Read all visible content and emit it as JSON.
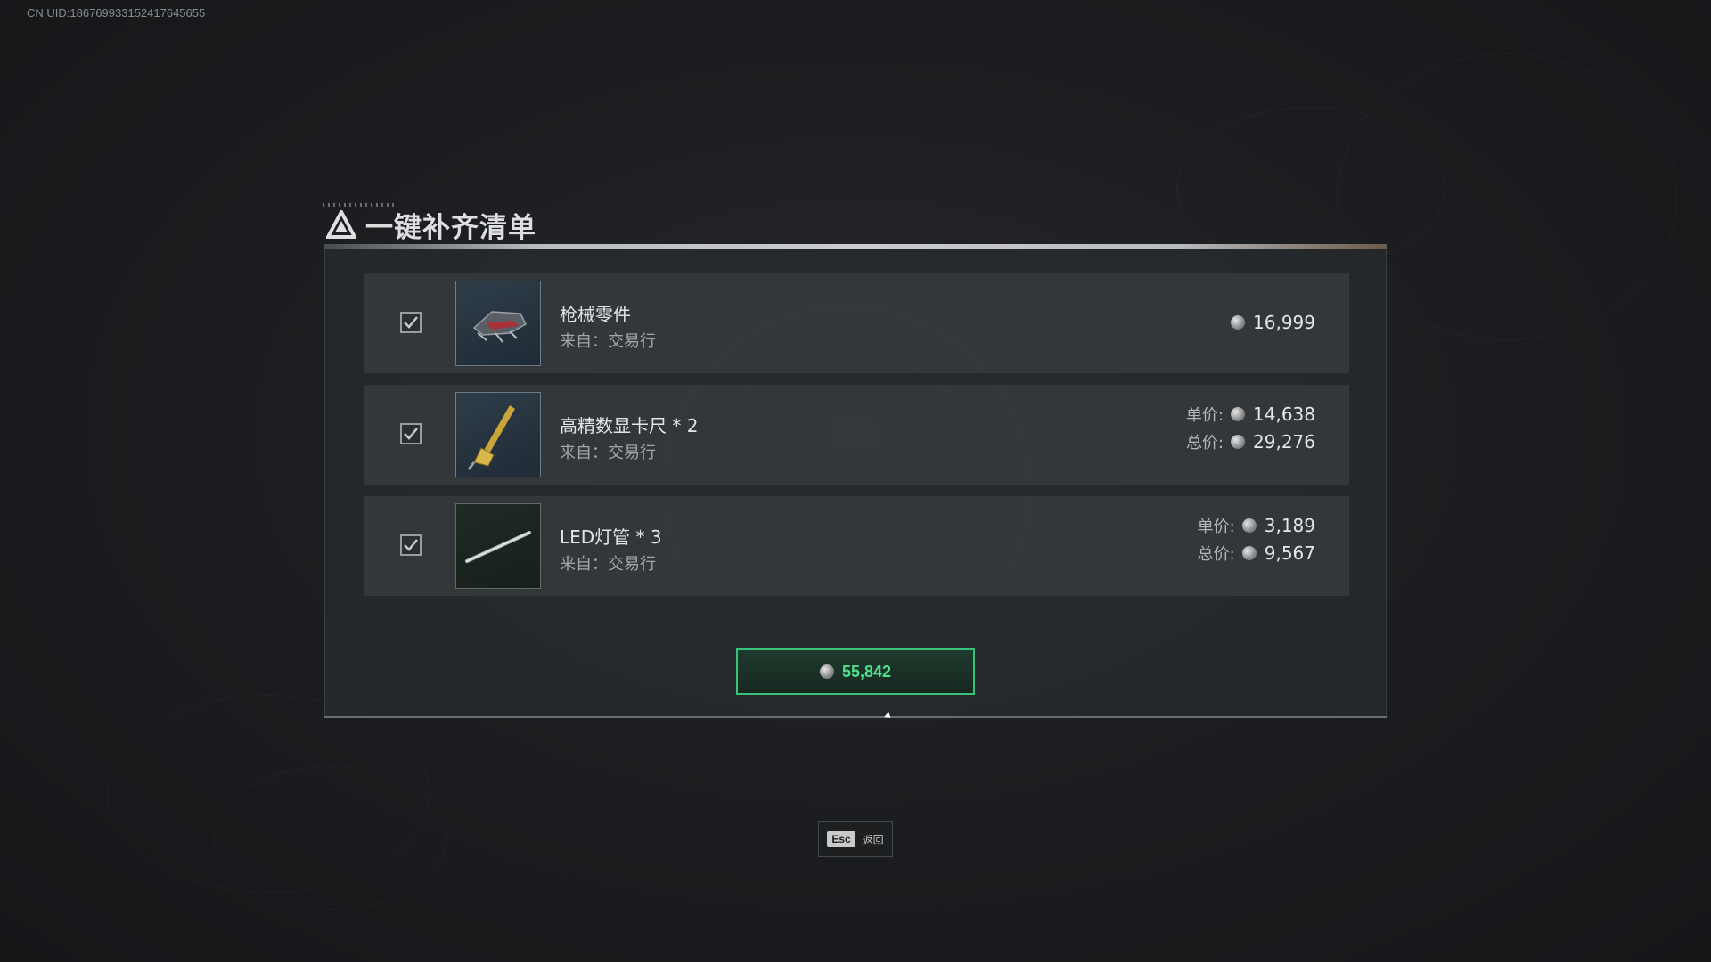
{
  "uid": "CN UID:18676993315241764565​5",
  "dialog": {
    "title": "一键补齐清单"
  },
  "items": [
    {
      "name": "枪械零件",
      "source": "来自：交易行",
      "checked": true,
      "icon": "gun-parts-icon",
      "price": "16,999"
    },
    {
      "name": "高精数显卡尺 * 2",
      "source": "来自：交易行",
      "checked": true,
      "icon": "digital-caliper-icon",
      "unit_label": "单价:",
      "unit_price": "14,638",
      "total_label": "总价:",
      "total_price": "29,276"
    },
    {
      "name": "LED灯管 * 3",
      "source": "来自：交易行",
      "checked": true,
      "icon": "led-tube-icon",
      "unit_label": "单价:",
      "unit_price": "3,189",
      "total_label": "总价:",
      "total_price": "9,567"
    }
  ],
  "total": {
    "amount": "55,842"
  },
  "footer": {
    "esc_key": "Esc",
    "esc_label": "返回"
  },
  "colors": {
    "accent_green": "#4fe08e",
    "panel_bg": "#282b2e",
    "row_bg": "#3a3d40"
  }
}
